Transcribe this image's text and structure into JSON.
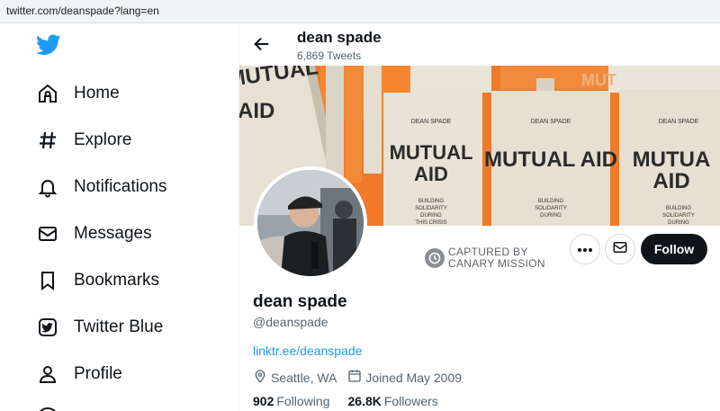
{
  "browser": {
    "url": "twitter.com/deanspade?lang=en"
  },
  "sidebar": {
    "logo_icon": "twitter-bird-icon",
    "items": [
      {
        "label": "Home",
        "icon": "home-icon"
      },
      {
        "label": "Explore",
        "icon": "hashtag-icon"
      },
      {
        "label": "Notifications",
        "icon": "bell-icon"
      },
      {
        "label": "Messages",
        "icon": "envelope-icon"
      },
      {
        "label": "Bookmarks",
        "icon": "bookmark-icon"
      },
      {
        "label": "Twitter Blue",
        "icon": "twitter-blue-icon"
      },
      {
        "label": "Profile",
        "icon": "person-icon"
      }
    ]
  },
  "header": {
    "name": "dean spade",
    "tweet_count": "6,869 Tweets"
  },
  "banner": {
    "book_title": "MUTUAL AID",
    "book_title_partial": "MUTUAL",
    "book_author": "DEAN SPADE",
    "book_subtitle": "BUILDING SOLIDARITY DURING THIS CRISIS"
  },
  "watermark": {
    "line1": "CAPTURED BY",
    "line2": "CANARY MISSION"
  },
  "actions": {
    "follow_label": "Follow"
  },
  "profile": {
    "name": "dean spade",
    "handle": "@deanspade",
    "link": "linktr.ee/deanspade",
    "location": "Seattle, WA",
    "joined": "Joined May 2009",
    "following_count": "902",
    "following_label": "Following",
    "followers_count": "26.8K",
    "followers_label": "Followers"
  },
  "colors": {
    "accent": "#1d9bf0",
    "banner_orange": "#f0731f",
    "follow_button": "#0f1419"
  }
}
